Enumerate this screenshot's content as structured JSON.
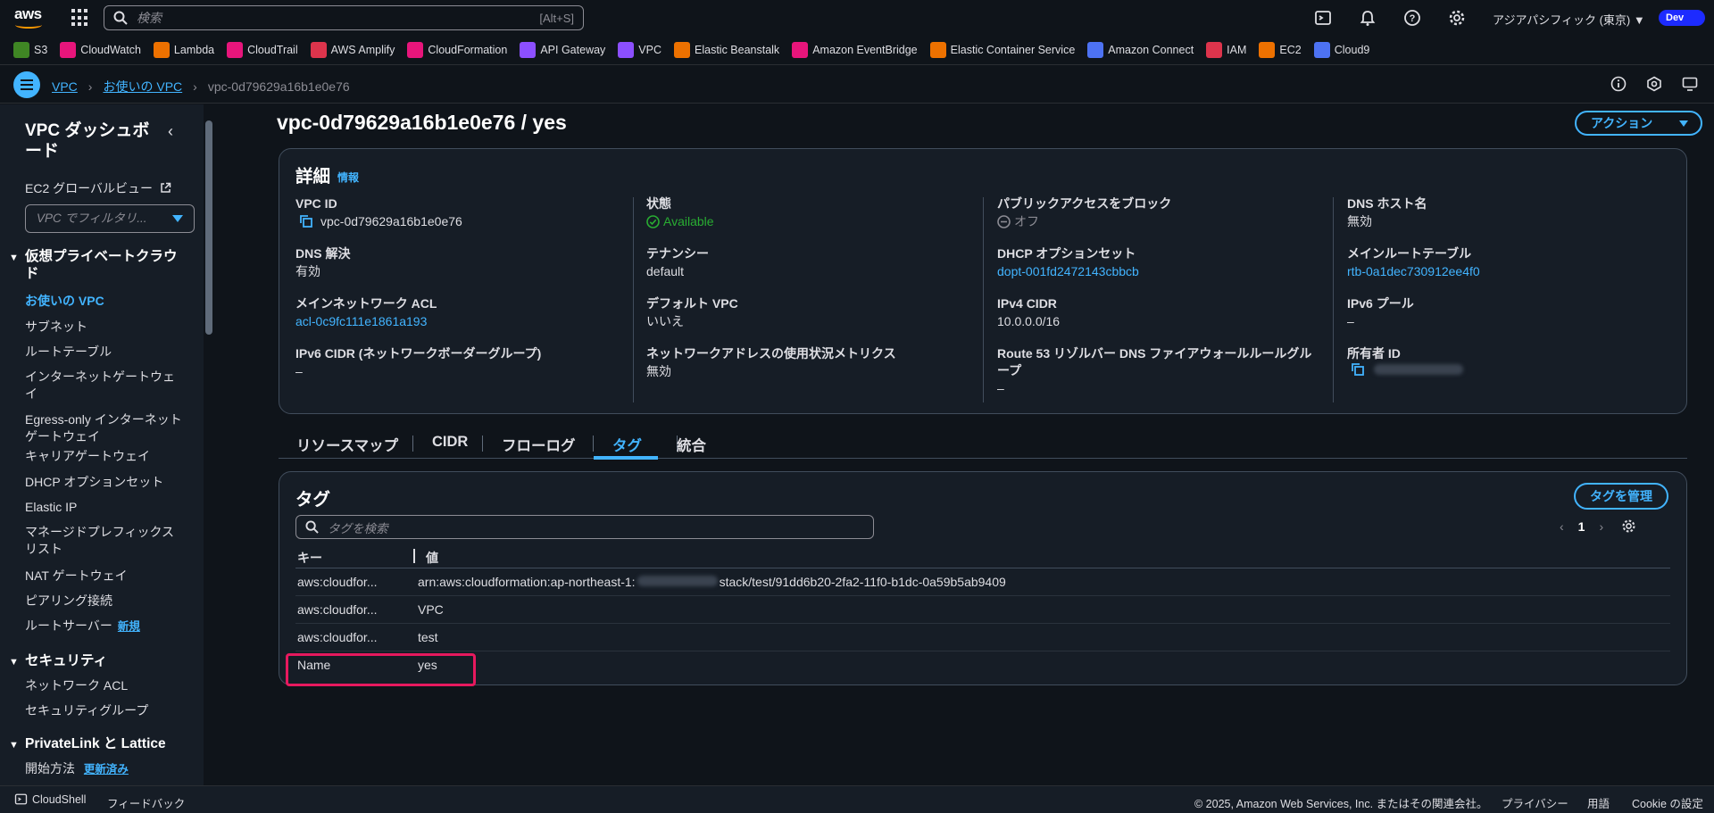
{
  "topnav": {
    "search_placeholder": "検索",
    "search_shortcut": "[Alt+S]",
    "region": "アジアパシフィック (東京) ▼",
    "account": "Dev"
  },
  "favorites": [
    {
      "label": "S3",
      "color": "#3f8624"
    },
    {
      "label": "CloudWatch",
      "color": "#e7157b"
    },
    {
      "label": "Lambda",
      "color": "#ed7100"
    },
    {
      "label": "CloudTrail",
      "color": "#e7157b"
    },
    {
      "label": "AWS Amplify",
      "color": "#dd344c"
    },
    {
      "label": "CloudFormation",
      "color": "#e7157b"
    },
    {
      "label": "API Gateway",
      "color": "#8c4fff"
    },
    {
      "label": "VPC",
      "color": "#8c4fff"
    },
    {
      "label": "Elastic Beanstalk",
      "color": "#ed7100"
    },
    {
      "label": "Amazon EventBridge",
      "color": "#e7157b"
    },
    {
      "label": "Elastic Container Service",
      "color": "#ed7100"
    },
    {
      "label": "Amazon Connect",
      "color": "#4d72f3"
    },
    {
      "label": "IAM",
      "color": "#dd344c"
    },
    {
      "label": "EC2",
      "color": "#ed7100"
    },
    {
      "label": "Cloud9",
      "color": "#4d72f3"
    }
  ],
  "breadcrumb": {
    "root": "VPC",
    "parent": "お使いの VPC",
    "current": "vpc-0d79629a16b1e0e76"
  },
  "sidebar": {
    "title": "VPC ダッシュボード",
    "ec2_global": "EC2 グローバルビュー",
    "filter_placeholder": "VPC でフィルタリ...",
    "section_vpc": "仮想プライベートクラウド",
    "vpc_items": [
      "お使いの VPC",
      "サブネット",
      "ルートテーブル",
      "インターネットゲートウェイ",
      "Egress-only インターネットゲートウェイ",
      "キャリアゲートウェイ",
      "DHCP オプションセット",
      "Elastic IP",
      "マネージドプレフィックスリスト",
      "NAT ゲートウェイ",
      "ピアリング接続",
      "ルートサーバー"
    ],
    "new_badge": "新規",
    "section_security": "セキュリティ",
    "security_items": [
      "ネットワーク ACL",
      "セキュリティグループ"
    ],
    "section_privatelink": "PrivateLink と Lattice",
    "privatelink_items": [
      "開始方法"
    ],
    "updated_badge": "更新済み"
  },
  "main": {
    "title": "vpc-0d79629a16b1e0e76 / yes",
    "action_button": "アクション",
    "details": {
      "heading": "詳細",
      "info_link": "情報",
      "vpc_id_label": "VPC ID",
      "vpc_id": "vpc-0d79629a16b1e0e76",
      "state_label": "状態",
      "state": "Available",
      "block_public_label": "パブリックアクセスをブロック",
      "block_public": "オフ",
      "dns_hostname_label": "DNS ホスト名",
      "dns_hostname": "無効",
      "dns_resolution_label": "DNS 解決",
      "dns_resolution": "有効",
      "tenancy_label": "テナンシー",
      "tenancy": "default",
      "dhcp_label": "DHCP オプションセット",
      "dhcp": "dopt-001fd2472143cbbcb",
      "main_route_label": "メインルートテーブル",
      "main_route": "rtb-0a1dec730912ee4f0",
      "main_acl_label": "メインネットワーク ACL",
      "main_acl": "acl-0c9fc111e1861a193",
      "default_vpc_label": "デフォルト VPC",
      "default_vpc": "いいえ",
      "ipv4_label": "IPv4 CIDR",
      "ipv4": "10.0.0.0/16",
      "ipv6_pool_label": "IPv6 プール",
      "ipv6_pool": "–",
      "ipv6_cidr_label": "IPv6 CIDR (ネットワークボーダーグループ)",
      "ipv6_cidr": "–",
      "net_metrics_label": "ネットワークアドレスの使用状況メトリクス",
      "net_metrics": "無効",
      "route53_label": "Route 53 リゾルバー DNS ファイアウォールルールグループ",
      "route53": "–",
      "owner_label": "所有者 ID"
    },
    "tabs": [
      "リソースマップ",
      "CIDR",
      "フローログ",
      "タグ",
      "統合"
    ],
    "active_tab": "タグ",
    "tags": {
      "heading": "タグ",
      "manage_button": "タグを管理",
      "search_placeholder": "タグを検索",
      "page": "1",
      "col_key": "キー",
      "col_value": "値",
      "rows": [
        {
          "key": "aws:cloudfor...",
          "value_prefix": "arn:aws:cloudformation:ap-northeast-1:",
          "value_suffix": "stack/test/91dd6b20-2fa2-11f0-b1dc-0a59b5ab9409"
        },
        {
          "key": "aws:cloudfor...",
          "value_prefix": "VPC",
          "value_suffix": ""
        },
        {
          "key": "aws:cloudfor...",
          "value_prefix": "test",
          "value_suffix": ""
        },
        {
          "key": "Name",
          "value_prefix": "yes",
          "value_suffix": ""
        }
      ]
    }
  },
  "footer": {
    "cloudshell": "CloudShell",
    "feedback": "フィードバック",
    "copyright": "© 2025, Amazon Web Services, Inc. またはその関連会社。",
    "privacy": "プライバシー",
    "terms": "用語",
    "cookie": "Cookie の設定"
  }
}
